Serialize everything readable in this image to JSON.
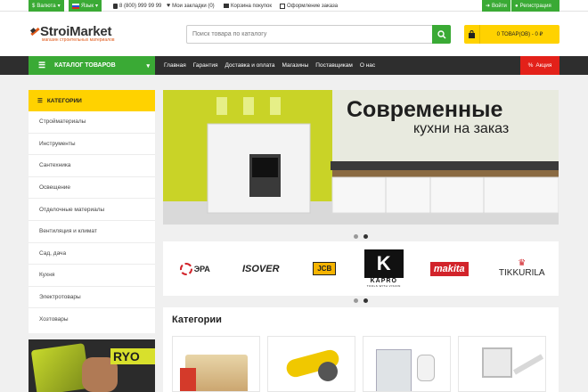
{
  "topbar": {
    "currency": "Валюта",
    "language": "Язык",
    "phone": "8 (800) 999 99 99",
    "bookmarks": "Мои закладки (0)",
    "cart_link": "Корзина покупок",
    "checkout": "Оформление заказа",
    "login": "Войти",
    "register": "Регистрация"
  },
  "header": {
    "logo": "StroiMarket",
    "tagline": "магазин строительных материалов",
    "search_placeholder": "Поиск товара по каталогу",
    "cart_summary": "0 ТОВАР(ОВ) - 0 ₽"
  },
  "nav": {
    "catalog": "КАТАЛОГ ТОВАРОВ",
    "links": [
      "Главная",
      "Гарантия",
      "Доставка и оплата",
      "Магазины",
      "Поставщикам",
      "О нас"
    ],
    "promo": "Акция"
  },
  "sidebar": {
    "title": "КАТЕГОРИИ",
    "items": [
      "Стройматериалы",
      "Инструменты",
      "Сантехника",
      "Освещение",
      "Отделочные материалы",
      "Вентиляция и климат",
      "Сад, дача",
      "Кухня",
      "Электротовары",
      "Хозтовары"
    ],
    "promo_brand": "RYO"
  },
  "banner": {
    "line1": "Современные",
    "line2": "кухни на заказ"
  },
  "brands": [
    "ЭРА",
    "ISOVER",
    "JCB",
    "KAPRO",
    "makita",
    "TIKKURILA"
  ],
  "brands_kapro_tagline": "TOOLS WITH VISION",
  "categories_title": "Категории",
  "colors": {
    "green": "#3aaa35",
    "yellow": "#ffd200",
    "dark": "#2e2e2e",
    "red": "#e32119"
  }
}
